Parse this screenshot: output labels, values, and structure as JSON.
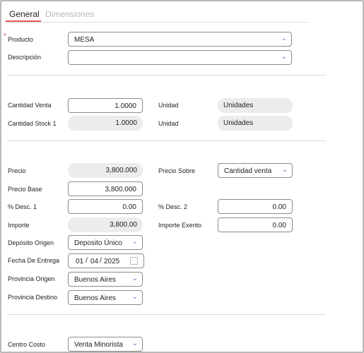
{
  "tabs": [
    "General",
    "Dimensiones"
  ],
  "required_mark": "*",
  "fields": {
    "producto": {
      "label": "Producto",
      "value": "MESA"
    },
    "descripcion": {
      "label": "Descripción",
      "value": ""
    },
    "cantidad_venta": {
      "label": "Cantidad Venta",
      "value": "1.0000"
    },
    "unidad1": {
      "label": "Unidad",
      "value": "Unidades"
    },
    "cantidad_stock": {
      "label": "Cantidad Stock 1",
      "value": "1.0000"
    },
    "unidad2": {
      "label": "Unidad",
      "value": "Unidades"
    },
    "precio": {
      "label": "Precio",
      "value": "3,800.000"
    },
    "precio_sobre": {
      "label": "Precio Sobre",
      "value": "Cantidad venta"
    },
    "precio_base": {
      "label": "Precio Base",
      "value": "3,800.000"
    },
    "desc1": {
      "label": "% Desc. 1",
      "value": "0.00"
    },
    "desc2": {
      "label": "% Desc. 2",
      "value": "0.00"
    },
    "importe": {
      "label": "Importe",
      "value": "3,800.00"
    },
    "importe_exento": {
      "label": "Importe Exento",
      "value": "0.00"
    },
    "deposito_origen": {
      "label": "Depósito Origen",
      "value": "Deposito Único"
    },
    "fecha_entrega": {
      "label": "Fecha De Entrega",
      "day": "01",
      "month": "04",
      "year": "2025",
      "sep": "/"
    },
    "provincia_origen": {
      "label": "Provincia Origen",
      "value": "Buenos Aires"
    },
    "provincia_destino": {
      "label": "Provincia Destino",
      "value": "Buenos Aires"
    },
    "centro_costo": {
      "label": "Centro Costo",
      "value": "Venta Minorista"
    }
  },
  "icons": {
    "dropdown": "chevron-down-icon",
    "calendar": "calendar-icon"
  },
  "colors": {
    "tab_accent": "#e9594a",
    "caret": "#5c7fbf"
  }
}
